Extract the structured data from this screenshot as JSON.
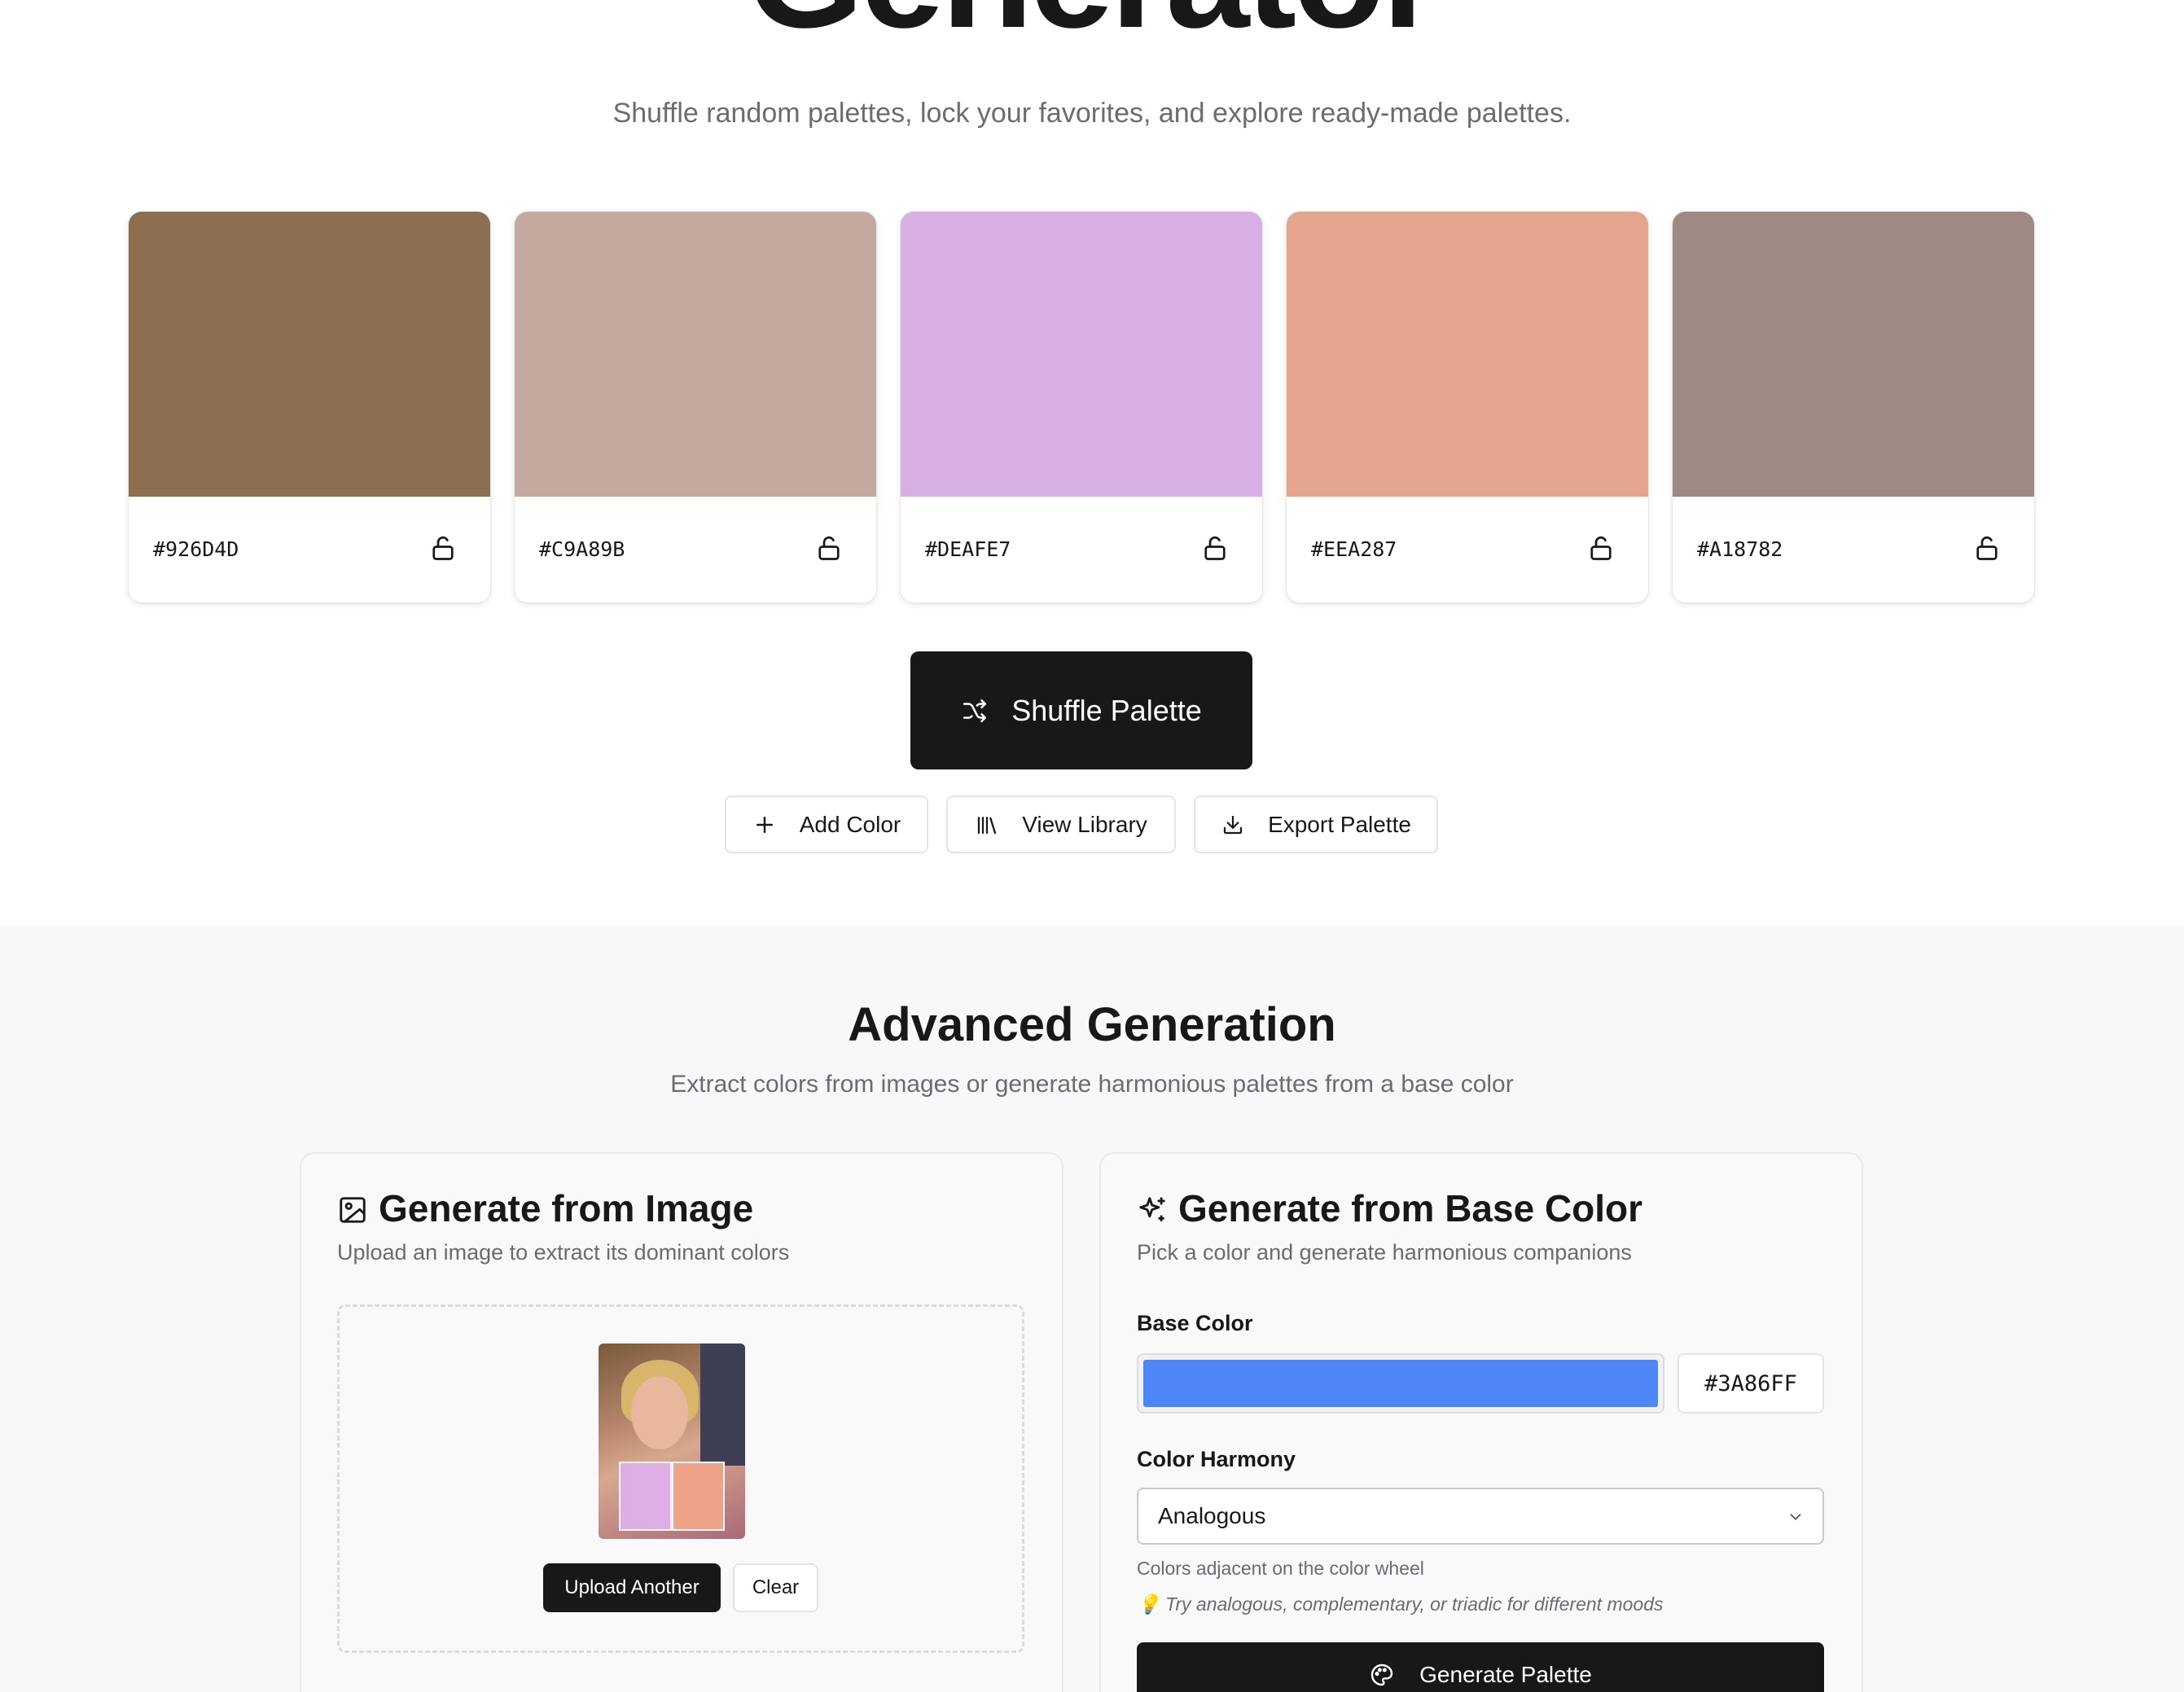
{
  "hero": {
    "title": "Generator",
    "subtitle": "Shuffle random palettes, lock your favorites, and explore ready-made palettes."
  },
  "palette": [
    {
      "hex_label": "#926D4D",
      "color": "#8C6E50",
      "locked": false,
      "lock_icon": "unlock-icon"
    },
    {
      "hex_label": "#C9A89B",
      "color": "#C4AA9E",
      "locked": false,
      "lock_icon": "unlock-icon"
    },
    {
      "hex_label": "#DEAFE7",
      "color": "#D7AFE4",
      "locked": false,
      "lock_icon": "unlock-icon"
    },
    {
      "hex_label": "#EEA287",
      "color": "#E3A58D",
      "locked": false,
      "lock_icon": "unlock-icon"
    },
    {
      "hex_label": "#A18782",
      "color": "#9F8984",
      "locked": false,
      "lock_icon": "unlock-icon"
    }
  ],
  "actions": {
    "shuffle_label": "Shuffle Palette",
    "shuffle_icon": "shuffle-icon",
    "add_color_label": "Add Color",
    "add_color_icon": "plus-icon",
    "view_library_label": "View Library",
    "view_library_icon": "library-icon",
    "export_label": "Export Palette",
    "export_icon": "download-icon"
  },
  "advanced": {
    "title": "Advanced Generation",
    "subtitle": "Extract colors from images or generate harmonious palettes from a base color",
    "image_card": {
      "title": "Generate from Image",
      "icon": "image-icon",
      "subtitle": "Upload an image to extract its dominant colors",
      "upload_another_label": "Upload Another",
      "clear_label": "Clear"
    },
    "base_card": {
      "title": "Generate from Base Color",
      "icon": "sparkles-icon",
      "subtitle": "Pick a color and generate harmonious companions",
      "base_color_label": "Base Color",
      "base_color_value": "#3A86FF",
      "base_color_swatch": "#4F86F7",
      "harmony_label": "Color Harmony",
      "harmony_selected": "Analogous",
      "harmony_description": "Colors adjacent on the color wheel",
      "tip": "💡 Try analogous, complementary, or triadic for different moods",
      "generate_label": "Generate Palette",
      "generate_icon": "palette-icon"
    }
  }
}
